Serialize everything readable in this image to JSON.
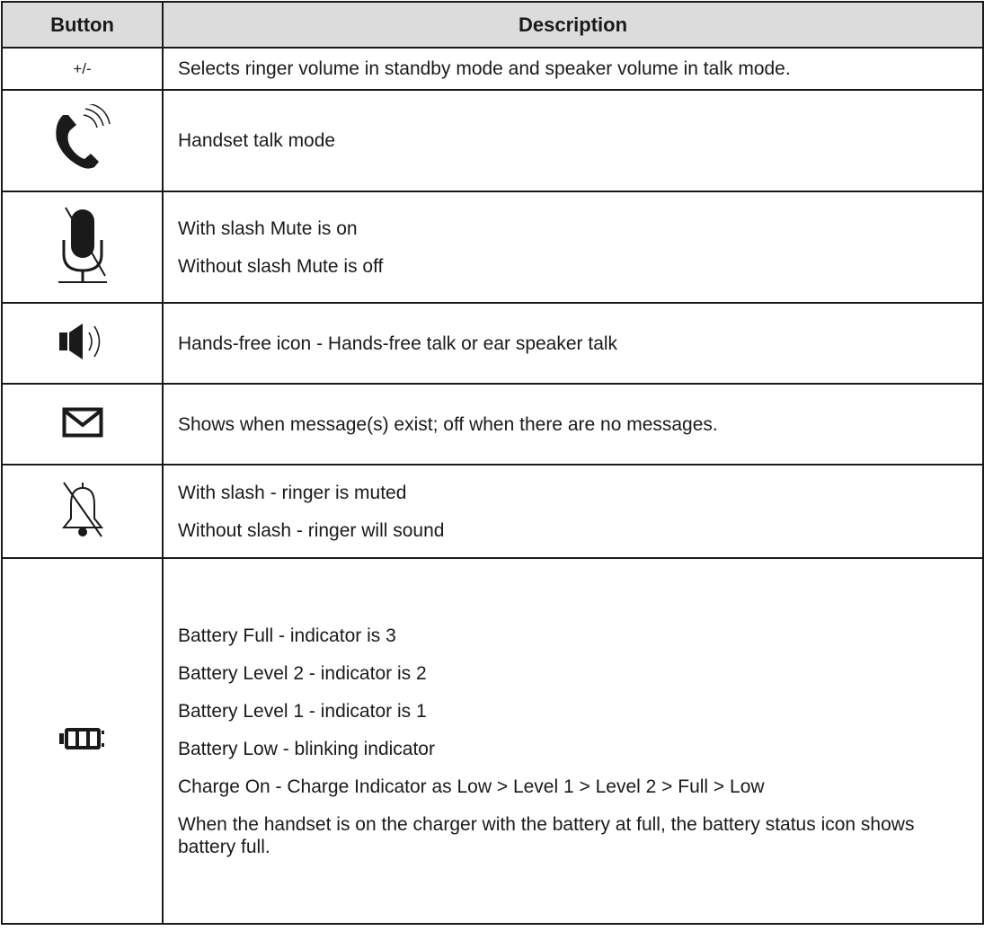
{
  "table": {
    "headers": {
      "button": "Button",
      "description": "Description"
    },
    "rows": [
      {
        "button_text": "+/-",
        "icon": "",
        "lines": [
          "Selects ringer volume in standby mode and speaker volume in talk mode."
        ]
      },
      {
        "button_text": "",
        "icon": "phone-handset-icon",
        "lines": [
          "Handset talk mode"
        ]
      },
      {
        "button_text": "",
        "icon": "microphone-slash-icon",
        "lines": [
          "With slash Mute is on",
          "Without slash Mute is off"
        ]
      },
      {
        "button_text": "",
        "icon": "speaker-icon",
        "lines": [
          "Hands-free icon - Hands-free talk or ear speaker talk"
        ]
      },
      {
        "button_text": "",
        "icon": "envelope-icon",
        "lines": [
          "Shows when message(s) exist; off when there are no messages."
        ]
      },
      {
        "button_text": "",
        "icon": "bell-slash-icon",
        "lines": [
          "With slash - ringer is muted",
          "Without slash - ringer will sound"
        ]
      },
      {
        "button_text": "",
        "icon": "battery-full-icon",
        "lines": [
          "Battery Full - indicator is 3",
          "Battery Level 2 - indicator is 2",
          "Battery Level 1 - indicator is 1",
          "Battery Low - blinking indicator",
          "Charge On - Charge Indicator as Low > Level 1 > Level 2 > Full > Low",
          "When the handset is on the charger with the battery at full, the battery status icon shows battery full."
        ]
      }
    ]
  }
}
